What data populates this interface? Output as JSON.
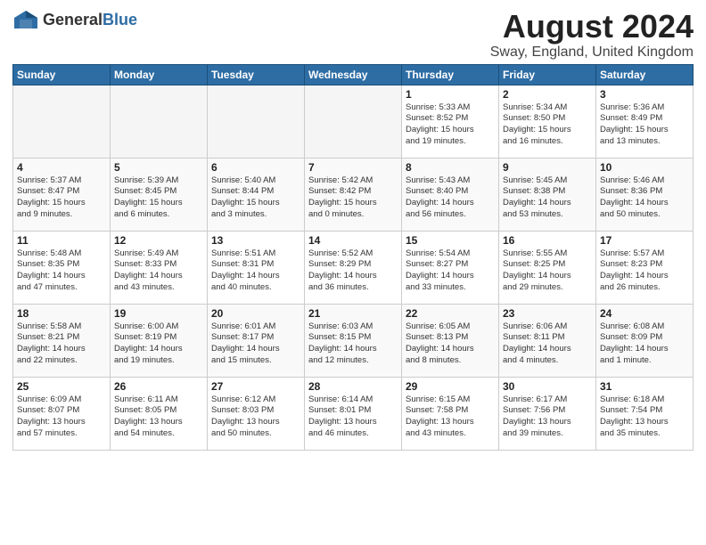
{
  "header": {
    "logo_general": "General",
    "logo_blue": "Blue",
    "month_title": "August 2024",
    "location": "Sway, England, United Kingdom"
  },
  "days_of_week": [
    "Sunday",
    "Monday",
    "Tuesday",
    "Wednesday",
    "Thursday",
    "Friday",
    "Saturday"
  ],
  "weeks": [
    [
      {
        "day": "",
        "empty": true
      },
      {
        "day": "",
        "empty": true
      },
      {
        "day": "",
        "empty": true
      },
      {
        "day": "",
        "empty": true
      },
      {
        "day": "1",
        "info": "Sunrise: 5:33 AM\nSunset: 8:52 PM\nDaylight: 15 hours\nand 19 minutes."
      },
      {
        "day": "2",
        "info": "Sunrise: 5:34 AM\nSunset: 8:50 PM\nDaylight: 15 hours\nand 16 minutes."
      },
      {
        "day": "3",
        "info": "Sunrise: 5:36 AM\nSunset: 8:49 PM\nDaylight: 15 hours\nand 13 minutes."
      }
    ],
    [
      {
        "day": "4",
        "info": "Sunrise: 5:37 AM\nSunset: 8:47 PM\nDaylight: 15 hours\nand 9 minutes."
      },
      {
        "day": "5",
        "info": "Sunrise: 5:39 AM\nSunset: 8:45 PM\nDaylight: 15 hours\nand 6 minutes."
      },
      {
        "day": "6",
        "info": "Sunrise: 5:40 AM\nSunset: 8:44 PM\nDaylight: 15 hours\nand 3 minutes."
      },
      {
        "day": "7",
        "info": "Sunrise: 5:42 AM\nSunset: 8:42 PM\nDaylight: 15 hours\nand 0 minutes."
      },
      {
        "day": "8",
        "info": "Sunrise: 5:43 AM\nSunset: 8:40 PM\nDaylight: 14 hours\nand 56 minutes."
      },
      {
        "day": "9",
        "info": "Sunrise: 5:45 AM\nSunset: 8:38 PM\nDaylight: 14 hours\nand 53 minutes."
      },
      {
        "day": "10",
        "info": "Sunrise: 5:46 AM\nSunset: 8:36 PM\nDaylight: 14 hours\nand 50 minutes."
      }
    ],
    [
      {
        "day": "11",
        "info": "Sunrise: 5:48 AM\nSunset: 8:35 PM\nDaylight: 14 hours\nand 47 minutes."
      },
      {
        "day": "12",
        "info": "Sunrise: 5:49 AM\nSunset: 8:33 PM\nDaylight: 14 hours\nand 43 minutes."
      },
      {
        "day": "13",
        "info": "Sunrise: 5:51 AM\nSunset: 8:31 PM\nDaylight: 14 hours\nand 40 minutes."
      },
      {
        "day": "14",
        "info": "Sunrise: 5:52 AM\nSunset: 8:29 PM\nDaylight: 14 hours\nand 36 minutes."
      },
      {
        "day": "15",
        "info": "Sunrise: 5:54 AM\nSunset: 8:27 PM\nDaylight: 14 hours\nand 33 minutes."
      },
      {
        "day": "16",
        "info": "Sunrise: 5:55 AM\nSunset: 8:25 PM\nDaylight: 14 hours\nand 29 minutes."
      },
      {
        "day": "17",
        "info": "Sunrise: 5:57 AM\nSunset: 8:23 PM\nDaylight: 14 hours\nand 26 minutes."
      }
    ],
    [
      {
        "day": "18",
        "info": "Sunrise: 5:58 AM\nSunset: 8:21 PM\nDaylight: 14 hours\nand 22 minutes."
      },
      {
        "day": "19",
        "info": "Sunrise: 6:00 AM\nSunset: 8:19 PM\nDaylight: 14 hours\nand 19 minutes."
      },
      {
        "day": "20",
        "info": "Sunrise: 6:01 AM\nSunset: 8:17 PM\nDaylight: 14 hours\nand 15 minutes."
      },
      {
        "day": "21",
        "info": "Sunrise: 6:03 AM\nSunset: 8:15 PM\nDaylight: 14 hours\nand 12 minutes."
      },
      {
        "day": "22",
        "info": "Sunrise: 6:05 AM\nSunset: 8:13 PM\nDaylight: 14 hours\nand 8 minutes."
      },
      {
        "day": "23",
        "info": "Sunrise: 6:06 AM\nSunset: 8:11 PM\nDaylight: 14 hours\nand 4 minutes."
      },
      {
        "day": "24",
        "info": "Sunrise: 6:08 AM\nSunset: 8:09 PM\nDaylight: 14 hours\nand 1 minute."
      }
    ],
    [
      {
        "day": "25",
        "info": "Sunrise: 6:09 AM\nSunset: 8:07 PM\nDaylight: 13 hours\nand 57 minutes."
      },
      {
        "day": "26",
        "info": "Sunrise: 6:11 AM\nSunset: 8:05 PM\nDaylight: 13 hours\nand 54 minutes."
      },
      {
        "day": "27",
        "info": "Sunrise: 6:12 AM\nSunset: 8:03 PM\nDaylight: 13 hours\nand 50 minutes."
      },
      {
        "day": "28",
        "info": "Sunrise: 6:14 AM\nSunset: 8:01 PM\nDaylight: 13 hours\nand 46 minutes."
      },
      {
        "day": "29",
        "info": "Sunrise: 6:15 AM\nSunset: 7:58 PM\nDaylight: 13 hours\nand 43 minutes."
      },
      {
        "day": "30",
        "info": "Sunrise: 6:17 AM\nSunset: 7:56 PM\nDaylight: 13 hours\nand 39 minutes."
      },
      {
        "day": "31",
        "info": "Sunrise: 6:18 AM\nSunset: 7:54 PM\nDaylight: 13 hours\nand 35 minutes."
      }
    ]
  ]
}
